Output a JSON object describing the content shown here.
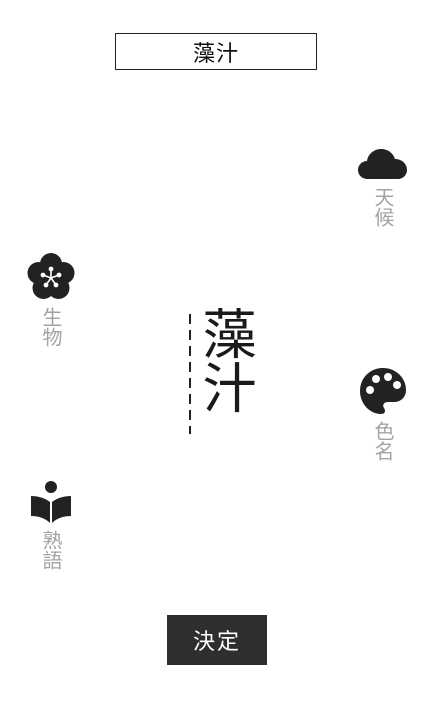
{
  "answer": {
    "text": "藻汁"
  },
  "categories": {
    "weather": {
      "label": "天候",
      "icon": "cloud-icon"
    },
    "creature": {
      "label": "生物",
      "icon": "plum-blossom-icon"
    },
    "color": {
      "label": "色名",
      "icon": "palette-icon"
    },
    "idiom": {
      "label": "熟語",
      "icon": "book-reader-icon"
    }
  },
  "glyph": {
    "text": "藻汁"
  },
  "actions": {
    "decide_label": "決定"
  },
  "colors": {
    "icon": "#222222",
    "label": "#a8a1a1",
    "button_bg": "#2e2e2e"
  }
}
